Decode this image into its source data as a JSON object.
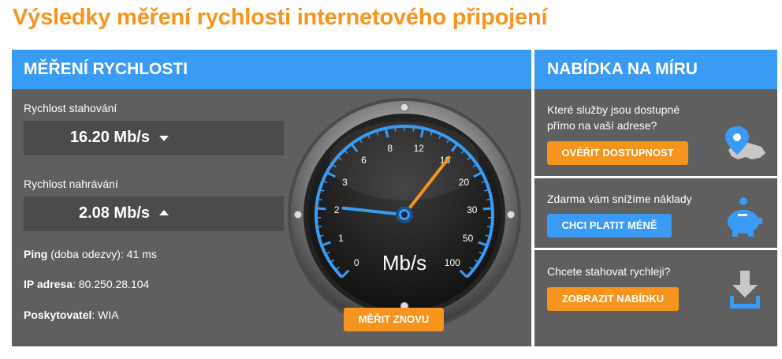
{
  "page": {
    "title": "Výsledky měření rychlosti internetového připojení"
  },
  "measurement": {
    "header": "MĚŘENÍ RYCHLOSTI",
    "download_label": "Rychlost stahování",
    "download_value": "16.20 Mb/s",
    "upload_label": "Rychlost nahrávání",
    "upload_value": "2.08 Mb/s",
    "ping_label": "Ping",
    "ping_rest": " (doba odezvy): 41 ms",
    "ip_label": "IP adresa",
    "ip_rest": ": 80.250.28.104",
    "provider_label": "Poskytovatel",
    "provider_rest": ": WIA",
    "retry_button": "MĚŘIT ZNOVU"
  },
  "gauge": {
    "unit": "Mb/s",
    "ticks": [
      "0",
      "1",
      "2",
      "3",
      "6",
      "8",
      "12",
      "16",
      "20",
      "30",
      "50",
      "100"
    ],
    "download_needle": 16.2,
    "upload_needle": 2.08,
    "accent_color": "#3a9bf5",
    "download_color": "#f7941d"
  },
  "offers": {
    "header": "NABÍDKA NA MÍRU",
    "items": [
      {
        "text": "Které služby jsou dostupné přímo na vaší adrese?",
        "button": "OVĚŘIT DOSTUPNOST",
        "button_style": "orange",
        "icon": "map-pin-icon"
      },
      {
        "text": "Zdarma vám snížíme náklady",
        "button": "CHCI PLATIT MÉNĚ",
        "button_style": "blue",
        "icon": "piggy-bank-icon"
      },
      {
        "text": "Chcete stahovat rychleji?",
        "button": "ZOBRAZIT NABÍDKU",
        "button_style": "orange",
        "icon": "download-icon"
      }
    ]
  },
  "colors": {
    "brand_orange": "#f7941d",
    "brand_blue": "#3a9bf5",
    "panel_gray": "#5f5f5f"
  }
}
